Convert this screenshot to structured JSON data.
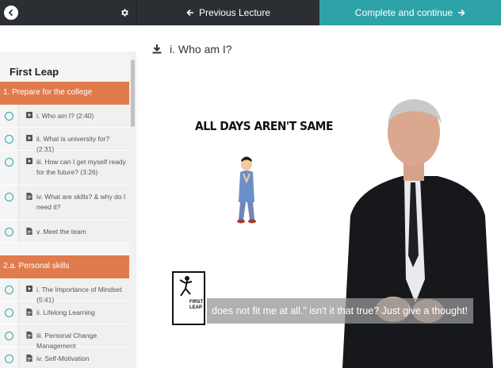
{
  "topbar": {
    "prev_label": "Previous Lecture",
    "next_label": "Complete and continue"
  },
  "sidebar": {
    "course_title": "First Leap",
    "sections": [
      {
        "title": "1. Prepare for the college",
        "items": [
          {
            "icon": "video-icon",
            "label": "i. Who am I? (2:40)"
          },
          {
            "icon": "video-icon",
            "label": "ii. What is university for? (2:31)"
          },
          {
            "icon": "video-icon",
            "label": "iii. How can I get myself ready for the future? (3:26)"
          },
          {
            "icon": "document-icon",
            "label": "iv. What are skills? & why do I need it?"
          },
          {
            "icon": "document-icon",
            "label": "v. Meet the team"
          }
        ]
      },
      {
        "title": "2.a. Personal skills",
        "items": [
          {
            "icon": "video-icon",
            "label": "i. The Importance of Mindset (5:41)"
          },
          {
            "icon": "document-icon",
            "label": "ii. Lifelong Learning"
          },
          {
            "icon": "document-icon",
            "label": "iii. Personal Change Management"
          },
          {
            "icon": "document-icon",
            "label": "iv. Self-Motivation"
          }
        ]
      }
    ]
  },
  "main": {
    "lecture_title": "i. Who am I?",
    "video": {
      "heading": "ALL DAYS AREN'T SAME",
      "logo_text": "FIRST LEAP",
      "subtitle": "does not fit me at all.\" isn't it that true? Just give a thought!"
    }
  },
  "colors": {
    "topbar_dark": "#2b2f33",
    "accent_teal": "#2ea3a7",
    "section_orange": "#e07b4c"
  }
}
